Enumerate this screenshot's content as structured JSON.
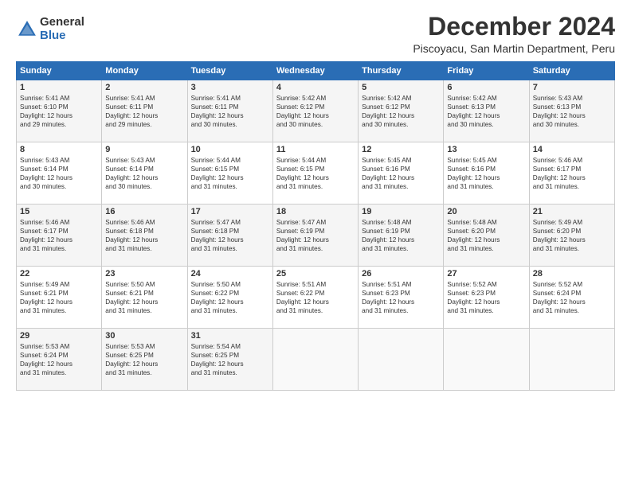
{
  "logo": {
    "general": "General",
    "blue": "Blue"
  },
  "title": "December 2024",
  "location": "Piscoyacu, San Martin Department, Peru",
  "headers": [
    "Sunday",
    "Monday",
    "Tuesday",
    "Wednesday",
    "Thursday",
    "Friday",
    "Saturday"
  ],
  "weeks": [
    [
      {
        "day": "1",
        "sunrise": "5:41 AM",
        "sunset": "6:10 PM",
        "daylight": "12 hours and 29 minutes."
      },
      {
        "day": "2",
        "sunrise": "5:41 AM",
        "sunset": "6:11 PM",
        "daylight": "12 hours and 29 minutes."
      },
      {
        "day": "3",
        "sunrise": "5:41 AM",
        "sunset": "6:11 PM",
        "daylight": "12 hours and 30 minutes."
      },
      {
        "day": "4",
        "sunrise": "5:42 AM",
        "sunset": "6:12 PM",
        "daylight": "12 hours and 30 minutes."
      },
      {
        "day": "5",
        "sunrise": "5:42 AM",
        "sunset": "6:12 PM",
        "daylight": "12 hours and 30 minutes."
      },
      {
        "day": "6",
        "sunrise": "5:42 AM",
        "sunset": "6:13 PM",
        "daylight": "12 hours and 30 minutes."
      },
      {
        "day": "7",
        "sunrise": "5:43 AM",
        "sunset": "6:13 PM",
        "daylight": "12 hours and 30 minutes."
      }
    ],
    [
      {
        "day": "8",
        "sunrise": "5:43 AM",
        "sunset": "6:14 PM",
        "daylight": "12 hours and 30 minutes."
      },
      {
        "day": "9",
        "sunrise": "5:43 AM",
        "sunset": "6:14 PM",
        "daylight": "12 hours and 30 minutes."
      },
      {
        "day": "10",
        "sunrise": "5:44 AM",
        "sunset": "6:15 PM",
        "daylight": "12 hours and 31 minutes."
      },
      {
        "day": "11",
        "sunrise": "5:44 AM",
        "sunset": "6:15 PM",
        "daylight": "12 hours and 31 minutes."
      },
      {
        "day": "12",
        "sunrise": "5:45 AM",
        "sunset": "6:16 PM",
        "daylight": "12 hours and 31 minutes."
      },
      {
        "day": "13",
        "sunrise": "5:45 AM",
        "sunset": "6:16 PM",
        "daylight": "12 hours and 31 minutes."
      },
      {
        "day": "14",
        "sunrise": "5:46 AM",
        "sunset": "6:17 PM",
        "daylight": "12 hours and 31 minutes."
      }
    ],
    [
      {
        "day": "15",
        "sunrise": "5:46 AM",
        "sunset": "6:17 PM",
        "daylight": "12 hours and 31 minutes."
      },
      {
        "day": "16",
        "sunrise": "5:46 AM",
        "sunset": "6:18 PM",
        "daylight": "12 hours and 31 minutes."
      },
      {
        "day": "17",
        "sunrise": "5:47 AM",
        "sunset": "6:18 PM",
        "daylight": "12 hours and 31 minutes."
      },
      {
        "day": "18",
        "sunrise": "5:47 AM",
        "sunset": "6:19 PM",
        "daylight": "12 hours and 31 minutes."
      },
      {
        "day": "19",
        "sunrise": "5:48 AM",
        "sunset": "6:19 PM",
        "daylight": "12 hours and 31 minutes."
      },
      {
        "day": "20",
        "sunrise": "5:48 AM",
        "sunset": "6:20 PM",
        "daylight": "12 hours and 31 minutes."
      },
      {
        "day": "21",
        "sunrise": "5:49 AM",
        "sunset": "6:20 PM",
        "daylight": "12 hours and 31 minutes."
      }
    ],
    [
      {
        "day": "22",
        "sunrise": "5:49 AM",
        "sunset": "6:21 PM",
        "daylight": "12 hours and 31 minutes."
      },
      {
        "day": "23",
        "sunrise": "5:50 AM",
        "sunset": "6:21 PM",
        "daylight": "12 hours and 31 minutes."
      },
      {
        "day": "24",
        "sunrise": "5:50 AM",
        "sunset": "6:22 PM",
        "daylight": "12 hours and 31 minutes."
      },
      {
        "day": "25",
        "sunrise": "5:51 AM",
        "sunset": "6:22 PM",
        "daylight": "12 hours and 31 minutes."
      },
      {
        "day": "26",
        "sunrise": "5:51 AM",
        "sunset": "6:23 PM",
        "daylight": "12 hours and 31 minutes."
      },
      {
        "day": "27",
        "sunrise": "5:52 AM",
        "sunset": "6:23 PM",
        "daylight": "12 hours and 31 minutes."
      },
      {
        "day": "28",
        "sunrise": "5:52 AM",
        "sunset": "6:24 PM",
        "daylight": "12 hours and 31 minutes."
      }
    ],
    [
      {
        "day": "29",
        "sunrise": "5:53 AM",
        "sunset": "6:24 PM",
        "daylight": "12 hours and 31 minutes."
      },
      {
        "day": "30",
        "sunrise": "5:53 AM",
        "sunset": "6:25 PM",
        "daylight": "12 hours and 31 minutes."
      },
      {
        "day": "31",
        "sunrise": "5:54 AM",
        "sunset": "6:25 PM",
        "daylight": "12 hours and 31 minutes."
      },
      null,
      null,
      null,
      null
    ]
  ],
  "labels": {
    "sunrise": "Sunrise:",
    "sunset": "Sunset:",
    "daylight": "Daylight:"
  }
}
